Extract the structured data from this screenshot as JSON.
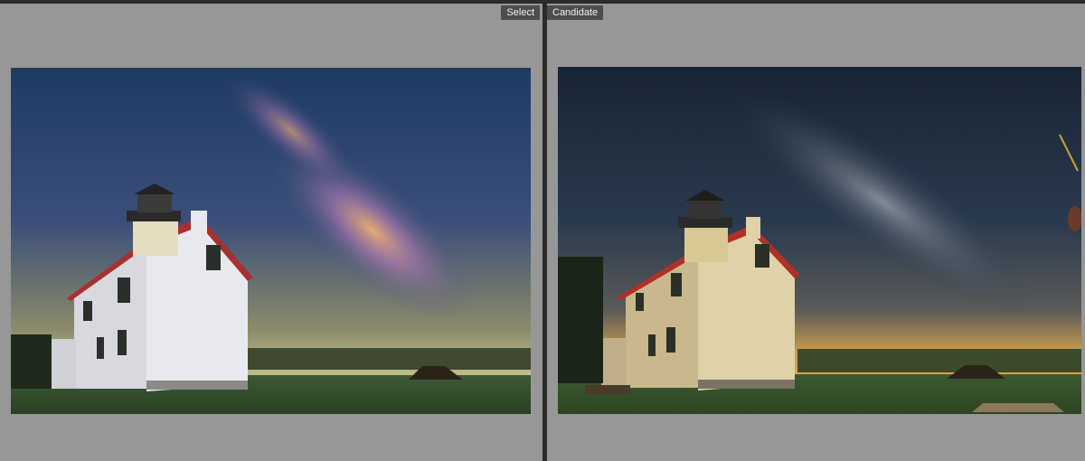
{
  "panes": {
    "select": {
      "label": "Select"
    },
    "candidate": {
      "label": "Candidate"
    }
  },
  "colors": {
    "background": "#979797",
    "divider": "#2b2b2b",
    "tag_background": "#4d4d4d",
    "tag_text": "#f2f2f2"
  }
}
